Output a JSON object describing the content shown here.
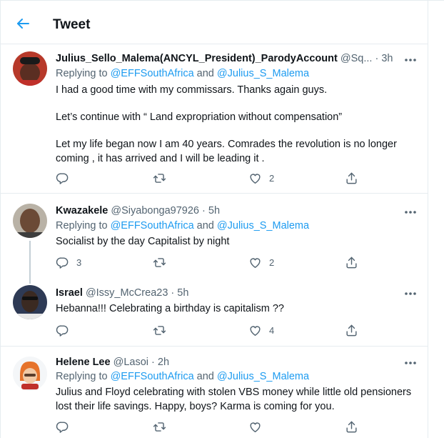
{
  "header": {
    "title": "Tweet"
  },
  "tweets": [
    {
      "name": "Julius_Sello_Malema(ANCYL_President)_ParodyAccount",
      "handle": "@Sq...",
      "time": "3h",
      "replying_prefix": "Replying to",
      "mention1": "@EFFSouthAfrica",
      "and": "and",
      "mention2": "@Julius_S_Malema",
      "text": [
        "I had a good time with my commissars. Thanks again guys.",
        "Let’s continue with “ Land expropriation without compensation”",
        "Let my life began now I am 40 years. Comrades the revolution is no longer coming , it has arrived and I will be leading it ."
      ],
      "reply_count": "",
      "retweet_count": "",
      "like_count": "2"
    },
    {
      "name": "Kwazakele",
      "handle": "@Siyabonga97926",
      "time": "5h",
      "replying_prefix": "Replying to",
      "mention1": "@EFFSouthAfrica",
      "and": "and",
      "mention2": "@Julius_S_Malema",
      "text": [
        "Socialist by the day Capitalist by night"
      ],
      "reply_count": "3",
      "retweet_count": "",
      "like_count": "2"
    },
    {
      "name": "Israel",
      "handle": "@Issy_McCrea23",
      "time": "5h",
      "text": [
        "Hebanna!!! Celebrating a birthday is capitalism ??"
      ],
      "reply_count": "",
      "retweet_count": "",
      "like_count": "4"
    },
    {
      "name": "Helene Lee",
      "handle": "@Lasoi",
      "time": "2h",
      "replying_prefix": "Replying to",
      "mention1": "@EFFSouthAfrica",
      "and": "and",
      "mention2": "@Julius_S_Malema",
      "text": [
        "Julius and Floyd celebrating with stolen VBS money while little old pensioners lost their life savings. Happy, boys? Karma is coming for you."
      ],
      "reply_count": "",
      "retweet_count": "",
      "like_count": ""
    }
  ],
  "colors": {
    "accent": "#1d9bf0",
    "muted": "#536471",
    "text": "#0f1419",
    "border": "#e6ecf0"
  },
  "icons": [
    "back-arrow-icon",
    "more-icon",
    "reply-icon",
    "retweet-icon",
    "like-icon",
    "share-icon"
  ]
}
